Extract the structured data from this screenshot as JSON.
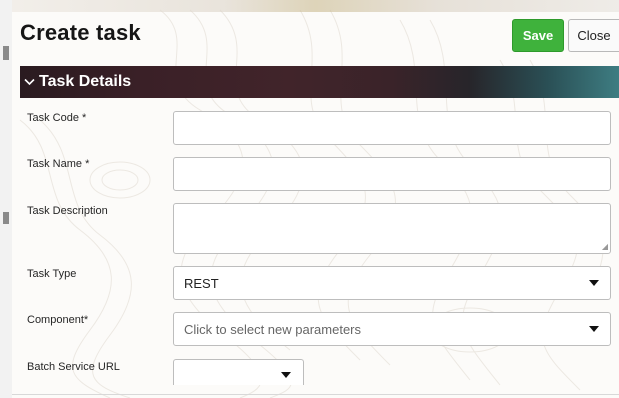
{
  "header": {
    "title": "Create task"
  },
  "toolbar": {
    "save_label": "Save",
    "close_label": "Close"
  },
  "section": {
    "title": "Task Details",
    "chevron_icon": "chevron-down-icon"
  },
  "fields": {
    "task_code": {
      "label": "Task Code",
      "required_mark": "*",
      "value": ""
    },
    "task_name": {
      "label": "Task Name",
      "required_mark": "*",
      "value": ""
    },
    "task_description": {
      "label": "Task Description",
      "value": ""
    },
    "task_type": {
      "label": "Task Type",
      "value": "REST"
    },
    "component": {
      "label": "Component",
      "required_mark": "*",
      "placeholder": "Click to select new parameters"
    },
    "batch_service_url": {
      "label": "Batch Service URL",
      "value": ""
    }
  },
  "colors": {
    "save_button": "#3fb23c",
    "section_header_start": "#2a1b20",
    "section_header_end": "#3e7d82"
  }
}
